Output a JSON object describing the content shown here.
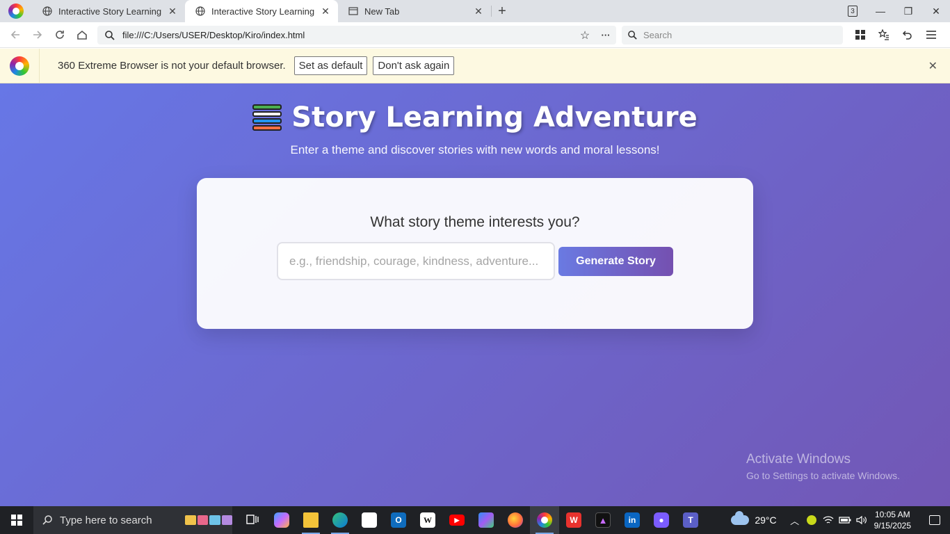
{
  "browser": {
    "name": "360 Extreme Browser",
    "tabs": [
      {
        "title": "Interactive Story Learning App",
        "active": false,
        "icon": "globe-icon"
      },
      {
        "title": "Interactive Story Learning App",
        "active": true,
        "icon": "globe-icon"
      },
      {
        "title": "New Tab",
        "active": false,
        "icon": "newtab-icon"
      }
    ],
    "tab_count": "3",
    "url": "file:///C:/Users/USER/Desktop/Kiro/index.html",
    "search_placeholder": "Search"
  },
  "infobar": {
    "message": "360 Extreme Browser is not your default browser.",
    "set_default_label": "Set as default",
    "dont_ask_label": "Don't ask again"
  },
  "app": {
    "title": "Story Learning Adventure",
    "title_icon": "books-icon",
    "subtitle": "Enter a theme and discover stories with new words and moral lessons!",
    "prompt_heading": "What story theme interests you?",
    "theme_input_placeholder": "e.g., friendship, courage, kindness, adventure...",
    "theme_input_value": "",
    "generate_button_label": "Generate Story",
    "colors": {
      "gradient_start": "#6777e6",
      "gradient_end": "#7257b5"
    }
  },
  "watermark": {
    "line1": "Activate Windows",
    "line2": "Go to Settings to activate Windows."
  },
  "taskbar": {
    "search_placeholder": "Type here to search",
    "apps": [
      "task-view-icon",
      "copilot-icon",
      "file-explorer-icon",
      "edge-icon",
      "microsoft-store-icon",
      "outlook-icon",
      "wikipedia-icon",
      "youtube-icon",
      "m365-icon",
      "firefox-icon",
      "360-browser-icon",
      "wps-office-icon",
      "affinity-icon",
      "linkedin-icon",
      "discord-icon",
      "teams-icon"
    ],
    "weather": "29°C",
    "time": "10:05 AM",
    "date": "9/15/2025"
  }
}
